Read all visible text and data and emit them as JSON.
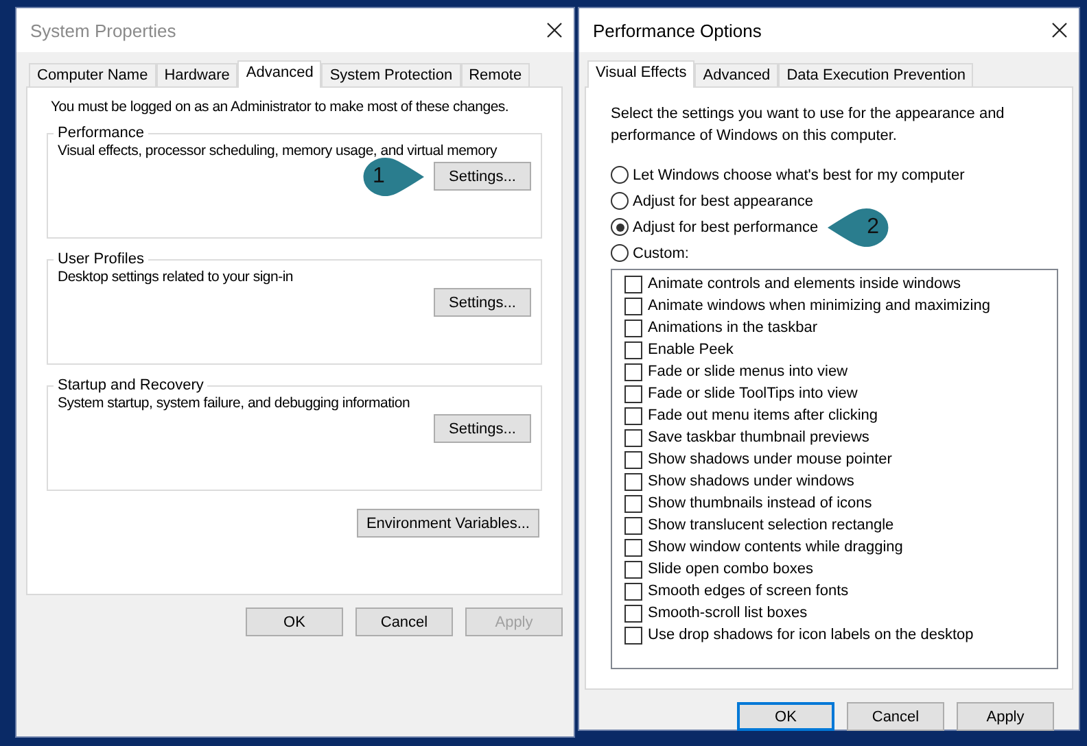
{
  "system_properties": {
    "title": "System Properties",
    "tabs": [
      {
        "label": "Computer Name",
        "selected": false
      },
      {
        "label": "Hardware",
        "selected": false
      },
      {
        "label": "Advanced",
        "selected": true
      },
      {
        "label": "System Protection",
        "selected": false
      },
      {
        "label": "Remote",
        "selected": false
      }
    ],
    "notice": "You must be logged on as an Administrator to make most of these changes.",
    "groups": [
      {
        "title": "Performance",
        "description": "Visual effects, processor scheduling, memory usage, and virtual memory",
        "button": "Settings...",
        "callout": "1"
      },
      {
        "title": "User Profiles",
        "description": "Desktop settings related to your sign-in",
        "button": "Settings..."
      },
      {
        "title": "Startup and Recovery",
        "description": "System startup, system failure, and debugging information",
        "button": "Settings..."
      }
    ],
    "environment_button": "Environment Variables...",
    "buttons": [
      {
        "label": "OK",
        "disabled": false
      },
      {
        "label": "Cancel",
        "disabled": false
      },
      {
        "label": "Apply",
        "disabled": true
      }
    ]
  },
  "performance_options": {
    "title": "Performance Options",
    "tabs": [
      {
        "label": "Visual Effects",
        "selected": true
      },
      {
        "label": "Advanced",
        "selected": false
      },
      {
        "label": "Data Execution Prevention",
        "selected": false
      }
    ],
    "intro": "Select the settings you want to use for the appearance and performance of Windows on this computer.",
    "options": [
      {
        "label": "Let Windows choose what's best for my computer",
        "selected": false
      },
      {
        "label": "Adjust for best appearance",
        "selected": false
      },
      {
        "label": "Adjust for best performance",
        "selected": true,
        "callout": "2"
      },
      {
        "label": "Custom:",
        "selected": false
      }
    ],
    "effects": [
      {
        "label": "Animate controls and elements inside windows",
        "checked": false
      },
      {
        "label": "Animate windows when minimizing and maximizing",
        "checked": false
      },
      {
        "label": "Animations in the taskbar",
        "checked": false
      },
      {
        "label": "Enable Peek",
        "checked": false
      },
      {
        "label": "Fade or slide menus into view",
        "checked": false
      },
      {
        "label": "Fade or slide ToolTips into view",
        "checked": false
      },
      {
        "label": "Fade out menu items after clicking",
        "checked": false
      },
      {
        "label": "Save taskbar thumbnail previews",
        "checked": false
      },
      {
        "label": "Show shadows under mouse pointer",
        "checked": false
      },
      {
        "label": "Show shadows under windows",
        "checked": false
      },
      {
        "label": "Show thumbnails instead of icons",
        "checked": false
      },
      {
        "label": "Show translucent selection rectangle",
        "checked": false
      },
      {
        "label": "Show window contents while dragging",
        "checked": false
      },
      {
        "label": "Slide open combo boxes",
        "checked": false
      },
      {
        "label": "Smooth edges of screen fonts",
        "checked": false
      },
      {
        "label": "Smooth-scroll list boxes",
        "checked": false
      },
      {
        "label": "Use drop shadows for icon labels on the desktop",
        "checked": false
      }
    ],
    "buttons": [
      {
        "label": "OK",
        "default": true
      },
      {
        "label": "Cancel",
        "default": false
      },
      {
        "label": "Apply",
        "default": false
      }
    ]
  }
}
